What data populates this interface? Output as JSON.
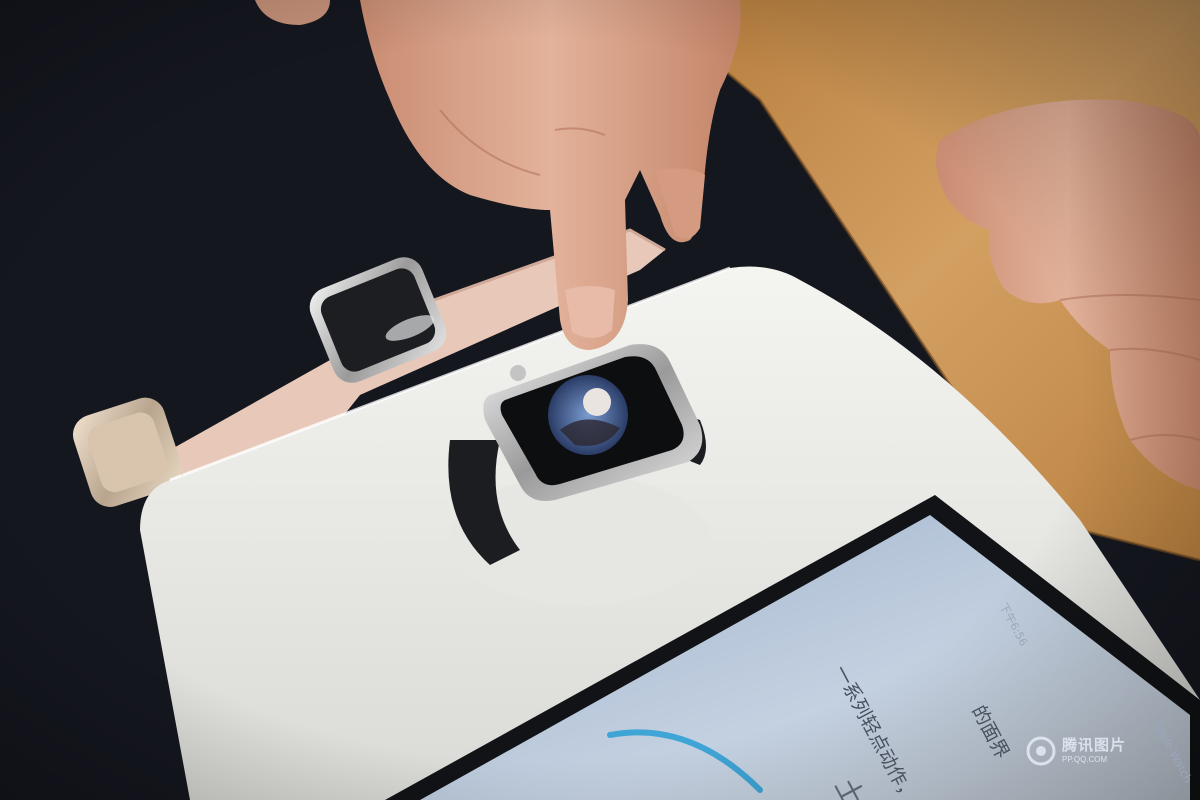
{
  "scene": {
    "background": "#15171f",
    "table_wood": "#c9924a",
    "tray_white": "#eeeeec",
    "ipad_screen": "#b9c8dc",
    "band_black": "#1b1c1e",
    "band_pink": "#e9cbbd",
    "skin": "#d69f84"
  },
  "ipad": {
    "line_action": "一系列轻点动作，",
    "line_interface": "的面界",
    "line_big": "土",
    "status_left": "下午6:56",
    "status_brand": "Apple Watch"
  },
  "watermark": {
    "title": "腾讯图片",
    "url": "PP.QQ.COM"
  }
}
